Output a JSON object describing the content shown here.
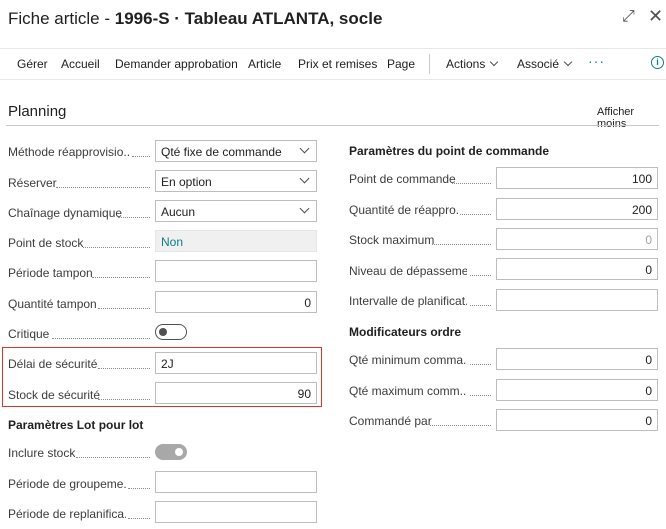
{
  "title": {
    "prefix": "Fiche article - ",
    "name": "1996-S · Tableau ATLANTA, socle"
  },
  "actions": {
    "gerer": "Gérer",
    "accueil": "Accueil",
    "demander": "Demander approbation",
    "article": "Article",
    "prix": "Prix et remises",
    "page": "Page",
    "actions": "Actions",
    "associe": "Associé",
    "more": "···",
    "info": "i"
  },
  "section": {
    "title": "Planning",
    "show_less": "Afficher moins"
  },
  "left": {
    "methode": {
      "label": "Méthode réapprovisio...",
      "value": "Qté fixe de commande"
    },
    "reserver": {
      "label": "Réserver",
      "value": "En option"
    },
    "chainage": {
      "label": "Chaînage dynamique",
      "value": "Aucun"
    },
    "point_stock": {
      "label": "Point de stock",
      "value": "Non"
    },
    "periode_tampon": {
      "label": "Période tampon",
      "value": ""
    },
    "quantite_tampon": {
      "label": "Quantité tampon",
      "value": "0"
    },
    "critique": {
      "label": "Critique",
      "on": false
    },
    "delai": {
      "label": "Délai de sécurité",
      "value": "2J"
    },
    "stock_securite": {
      "label": "Stock de sécurité",
      "value": "90"
    },
    "lot_header": "Paramètres Lot pour lot",
    "inclure": {
      "label": "Inclure stock",
      "on": true
    },
    "groupement": {
      "label": "Période de groupeme...",
      "value": ""
    },
    "replanif": {
      "label": "Période de replanifica...",
      "value": ""
    }
  },
  "right": {
    "header": "Paramètres du point de commande",
    "point_commande": {
      "label": "Point de commande",
      "value": "100"
    },
    "qte_reappro": {
      "label": "Quantité de réappro.",
      "value": "200"
    },
    "stock_max": {
      "label": "Stock maximum",
      "value": "0"
    },
    "niveau_depassement": {
      "label": "Niveau de dépasseme...",
      "value": "0"
    },
    "intervalle": {
      "label": "Intervalle de planificat...",
      "value": ""
    },
    "modif_header": "Modificateurs ordre",
    "qte_min": {
      "label": "Qté minimum comma...",
      "value": "0"
    },
    "qte_max": {
      "label": "Qté maximum comm...",
      "value": "0"
    },
    "commande_par": {
      "label": "Commandé par",
      "value": "0"
    }
  }
}
